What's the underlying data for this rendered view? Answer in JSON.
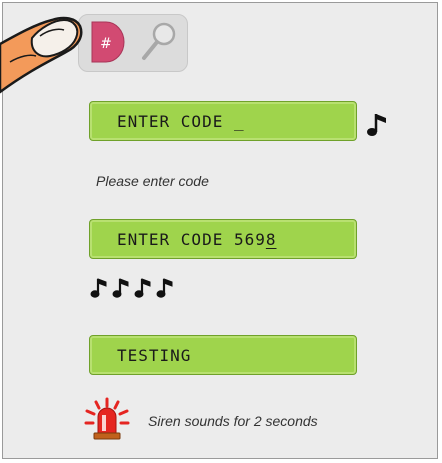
{
  "display_1": {
    "text": "ENTER CODE _"
  },
  "hint_1": "Please enter code",
  "display_2": {
    "text_prefix": "ENTER CODE 569",
    "text_cursor_digit": "8"
  },
  "display_3": {
    "text": "TESTING"
  },
  "hint_2": "Siren sounds for 2 seconds",
  "hash_key_symbol": "#",
  "colors": {
    "lcd_green": "#9fd44c",
    "hash_key": "#d24a72",
    "siren_red": "#e52521"
  }
}
